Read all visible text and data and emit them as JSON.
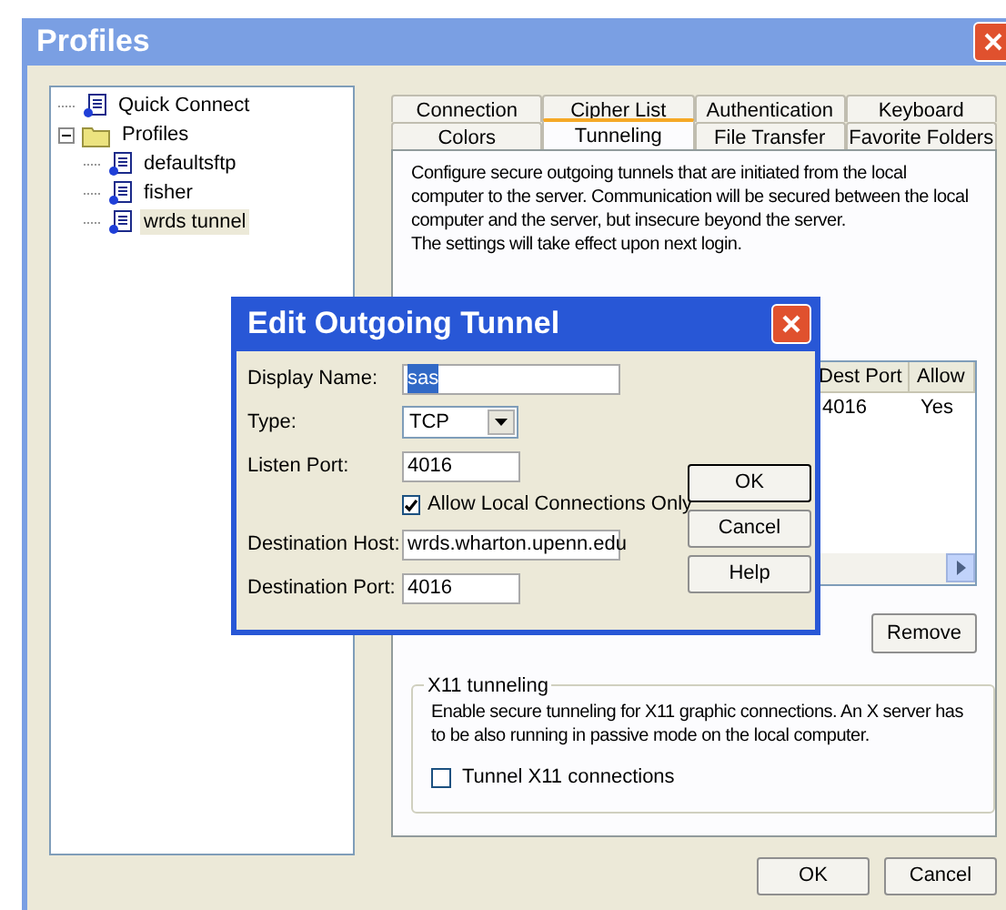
{
  "window": {
    "title": "Profiles"
  },
  "tree": [
    {
      "label": "Quick Connect",
      "kind": "profile",
      "selected": false
    },
    {
      "label": "Profiles",
      "kind": "folder",
      "expanded": true,
      "selected": false,
      "children": [
        {
          "label": "defaultsftp",
          "kind": "profile",
          "selected": false
        },
        {
          "label": "fisher",
          "kind": "profile",
          "selected": false
        },
        {
          "label": "wrds tunnel",
          "kind": "profile",
          "selected": true
        }
      ]
    }
  ],
  "tab_rows": [
    {
      "tabs": [
        {
          "label": "Connection",
          "selected": false
        },
        {
          "label": "Cipher List",
          "selected": false
        },
        {
          "label": "Authentication",
          "selected": false
        },
        {
          "label": "Keyboard",
          "selected": false
        }
      ]
    },
    {
      "tabs": [
        {
          "label": "Colors",
          "selected": false
        },
        {
          "label": "Tunneling",
          "selected": true
        },
        {
          "label": "File Transfer",
          "selected": false
        },
        {
          "label": "Favorite Folders",
          "selected": false
        }
      ]
    }
  ],
  "tunneling": {
    "description": [
      "Configure secure outgoing tunnels that are initiated from the local computer to the server. Communication will be secured between the local computer and the server, but insecure beyond the server.",
      "The settings will take effect upon next login."
    ],
    "table": {
      "columns": [
        "Dest Port",
        "Allow"
      ],
      "rows": [
        [
          "4016",
          "Yes"
        ]
      ]
    },
    "remove_button": "Remove"
  },
  "x11": {
    "title": "X11 tunneling",
    "description": "Enable secure tunneling for X11 graphic connections. An X server has to be also running in passive mode on the local computer.",
    "checkbox": {
      "label": "Tunnel X11 connections",
      "checked": false
    }
  },
  "buttons": [
    "OK",
    "Cancel"
  ],
  "dialog": {
    "title": "Edit Outgoing Tunnel",
    "fields": [
      {
        "kind": "text",
        "label": "Display Name:",
        "value": "sas",
        "highlighted": true,
        "wide": true
      },
      {
        "kind": "select",
        "label": "Type:",
        "value": "TCP"
      },
      {
        "kind": "text",
        "label": "Listen Port:",
        "value": "4016",
        "highlighted": false,
        "wide": false
      },
      {
        "kind": "checkbox",
        "label": "Allow Local Connections Only",
        "checked": true
      },
      {
        "kind": "text",
        "label": "Destination Host:",
        "value": "wrds.wharton.upenn.edu",
        "highlighted": false,
        "wide": true
      },
      {
        "kind": "text",
        "label": "Destination Port:",
        "value": "4016",
        "highlighted": false,
        "wide": false
      }
    ],
    "buttons": [
      "OK",
      "Cancel",
      "Help"
    ]
  }
}
